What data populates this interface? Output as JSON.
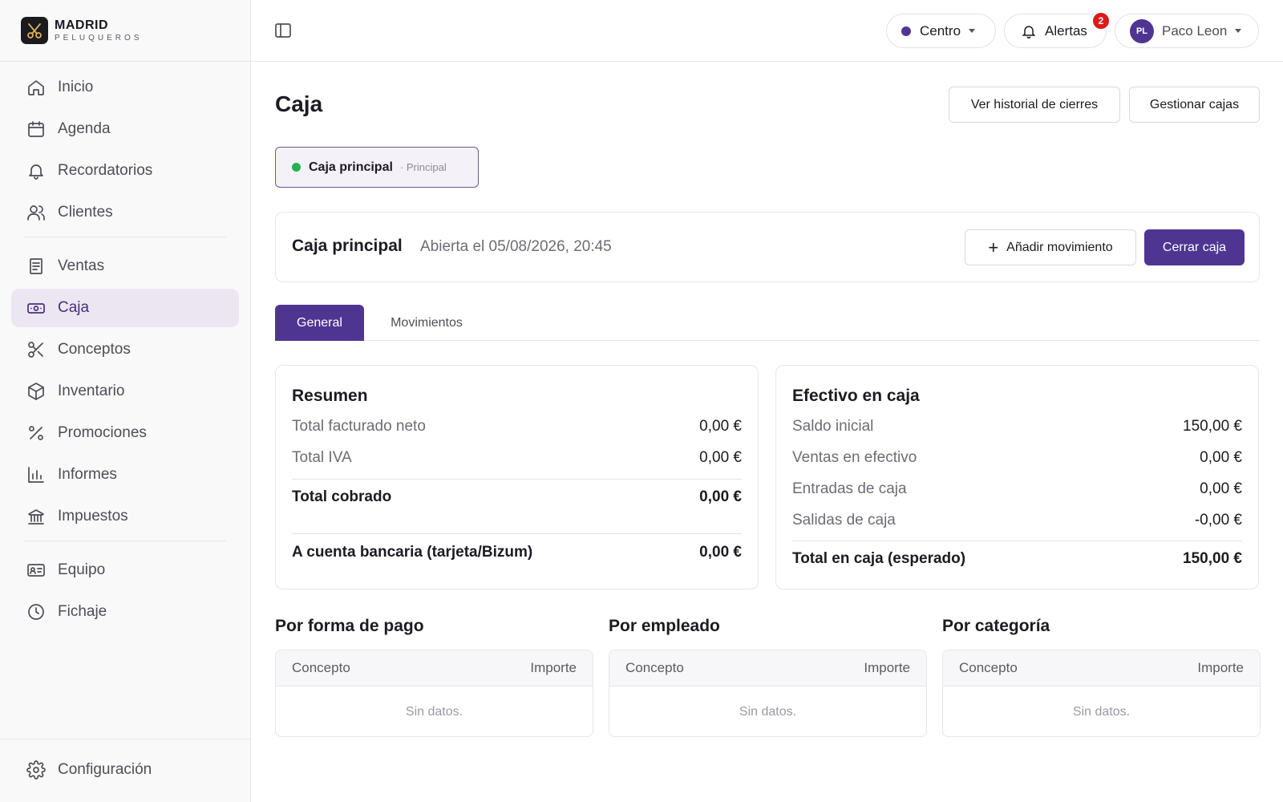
{
  "brand": {
    "name": "MADRID",
    "sub": "PELUQUEROS"
  },
  "sidebar": {
    "items": [
      {
        "label": "Inicio",
        "icon": "home-icon"
      },
      {
        "label": "Agenda",
        "icon": "calendar-icon"
      },
      {
        "label": "Recordatorios",
        "icon": "bell-icon"
      },
      {
        "label": "Clientes",
        "icon": "users-icon"
      },
      {
        "label": "Ventas",
        "icon": "receipt-icon"
      },
      {
        "label": "Caja",
        "icon": "banknote-icon",
        "active": true
      },
      {
        "label": "Conceptos",
        "icon": "scissors-icon"
      },
      {
        "label": "Inventario",
        "icon": "box-icon"
      },
      {
        "label": "Promociones",
        "icon": "percent-icon"
      },
      {
        "label": "Informes",
        "icon": "bar-chart-icon"
      },
      {
        "label": "Impuestos",
        "icon": "bank-icon"
      },
      {
        "label": "Equipo",
        "icon": "id-card-icon"
      },
      {
        "label": "Fichaje",
        "icon": "clock-icon"
      }
    ],
    "settings": {
      "label": "Configuración",
      "icon": "gear-icon"
    }
  },
  "topbar": {
    "location": "Centro",
    "alerts_label": "Alertas",
    "alerts_count": "2",
    "user_initials": "PL",
    "user_name": "Paco Leon"
  },
  "page": {
    "title": "Caja",
    "history_button": "Ver historial de cierres",
    "manage_button": "Gestionar cajas",
    "chip_name": "Caja principal",
    "chip_sub": "· Principal",
    "register_title": "Caja principal",
    "register_status": "Abierta el 05/08/2026, 20:45",
    "add_movement": "Añadir movimiento",
    "close_register": "Cerrar caja",
    "tabs": [
      "General",
      "Movimientos"
    ]
  },
  "summary": {
    "title": "Resumen",
    "rows": [
      {
        "label": "Total facturado neto",
        "value": "0,00 €"
      },
      {
        "label": "Total IVA",
        "value": "0,00 €"
      },
      {
        "label": "Total cobrado",
        "value": "0,00 €"
      },
      {
        "label": "A cuenta bancaria (tarjeta/Bizum)",
        "value": "0,00 €"
      }
    ]
  },
  "cash": {
    "title": "Efectivo en caja",
    "rows": [
      {
        "label": "Saldo inicial",
        "value": "150,00 €"
      },
      {
        "label": "Ventas en efectivo",
        "value": "0,00 €"
      },
      {
        "label": "Entradas de caja",
        "value": "0,00 €"
      },
      {
        "label": "Salidas de caja",
        "value": "-0,00 €"
      },
      {
        "label": "Total en caja (esperado)",
        "value": "150,00 €"
      }
    ]
  },
  "breakdowns": [
    {
      "title": "Por forma de pago",
      "col1": "Concepto",
      "col2": "Importe",
      "empty": "Sin datos."
    },
    {
      "title": "Por empleado",
      "col1": "Concepto",
      "col2": "Importe",
      "empty": "Sin datos."
    },
    {
      "title": "Por categoría",
      "col1": "Concepto",
      "col2": "Importe",
      "empty": "Sin datos."
    }
  ],
  "colors": {
    "accent": "#4f3592",
    "active_bg": "#ebe6f1",
    "open_status": "#21b44f",
    "badge": "#e01919"
  }
}
